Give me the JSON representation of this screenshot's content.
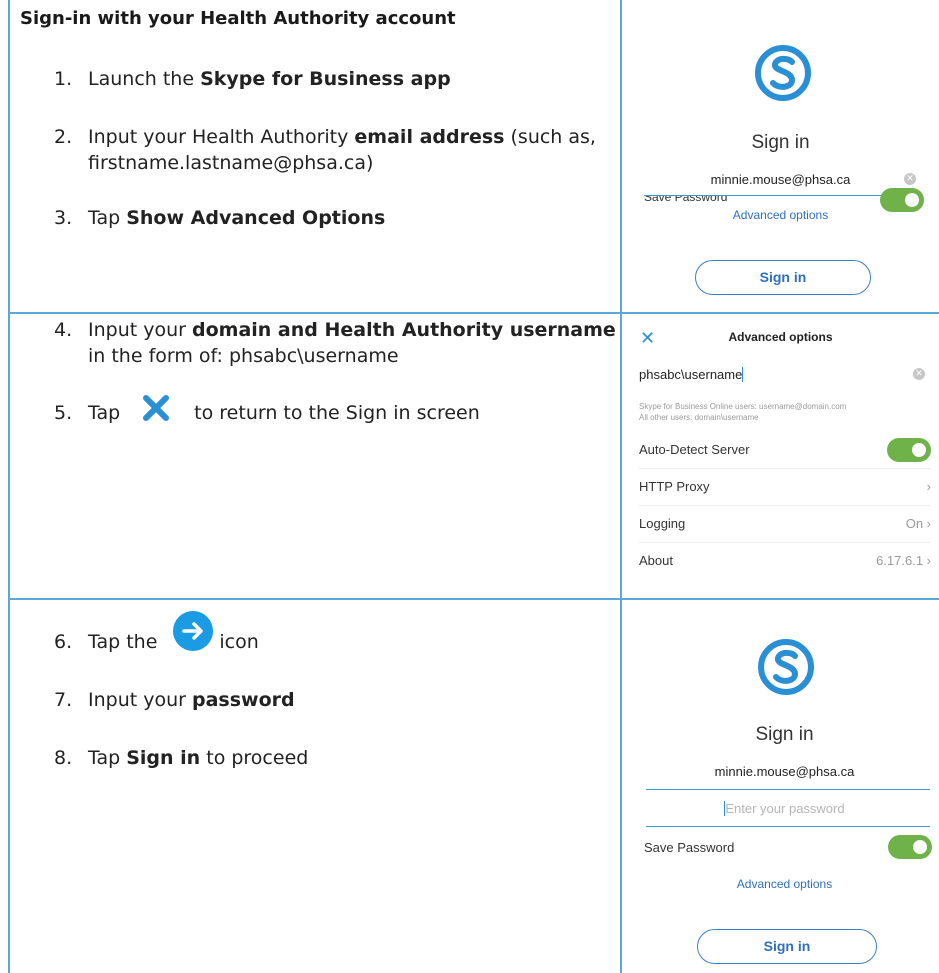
{
  "heading": "Sign-in with your Health Authority account",
  "steps": {
    "s1": {
      "num": "1.",
      "pre": "Launch the ",
      "bold": "Skype for Business app"
    },
    "s2": {
      "num": "2.",
      "pre": "Input your Health Authority ",
      "bold": "email address",
      "post": " (such as,",
      "cont": "firstname.lastname@phsa.ca)"
    },
    "s3": {
      "num": "3.",
      "pre": "Tap ",
      "bold": "Show Advanced Options"
    },
    "s4": {
      "num": "4.",
      "pre": "Input your ",
      "bold": "domain and Health Authority username",
      "cont": "in the form of: phsabc\\username"
    },
    "s5": {
      "num": "5.",
      "pre": "Tap",
      "post": "to return to the Sign in screen"
    },
    "s6": {
      "num": "6.",
      "pre": "Tap the",
      "post": "icon"
    },
    "s7": {
      "num": "7.",
      "pre": "Input your ",
      "bold": "password"
    },
    "s8": {
      "num": "8.",
      "pre": "Tap ",
      "bold": "Sign in",
      "post": " to proceed"
    }
  },
  "panel1": {
    "title": "Sign in",
    "email": "minnie.mouse@phsa.ca",
    "save_password": "Save Password",
    "advanced_link": "Advanced options",
    "signin_button": "Sign in"
  },
  "panel2": {
    "title": "Advanced options",
    "close_glyph": "✕",
    "input_value": "phsabc\\username",
    "hint1": "Skype for Business Online users: username@domain.com",
    "hint2": "All other users: domain\\username",
    "rows": [
      {
        "label": "Auto-Detect Server",
        "value": ""
      },
      {
        "label": "HTTP Proxy",
        "value": "›"
      },
      {
        "label": "Logging",
        "value": "On ›"
      },
      {
        "label": "About",
        "value": "6.17.6.1 ›"
      }
    ]
  },
  "panel3": {
    "title": "Sign in",
    "email": "minnie.mouse@phsa.ca",
    "password_placeholder": "Enter your password",
    "save_password": "Save Password",
    "advanced_link": "Advanced options",
    "signin_button": "Sign in"
  },
  "colors": {
    "accent": "#2b8fd6",
    "border": "#5aa7d8",
    "toggle": "#6fb24a",
    "link": "#2f6fbf"
  }
}
